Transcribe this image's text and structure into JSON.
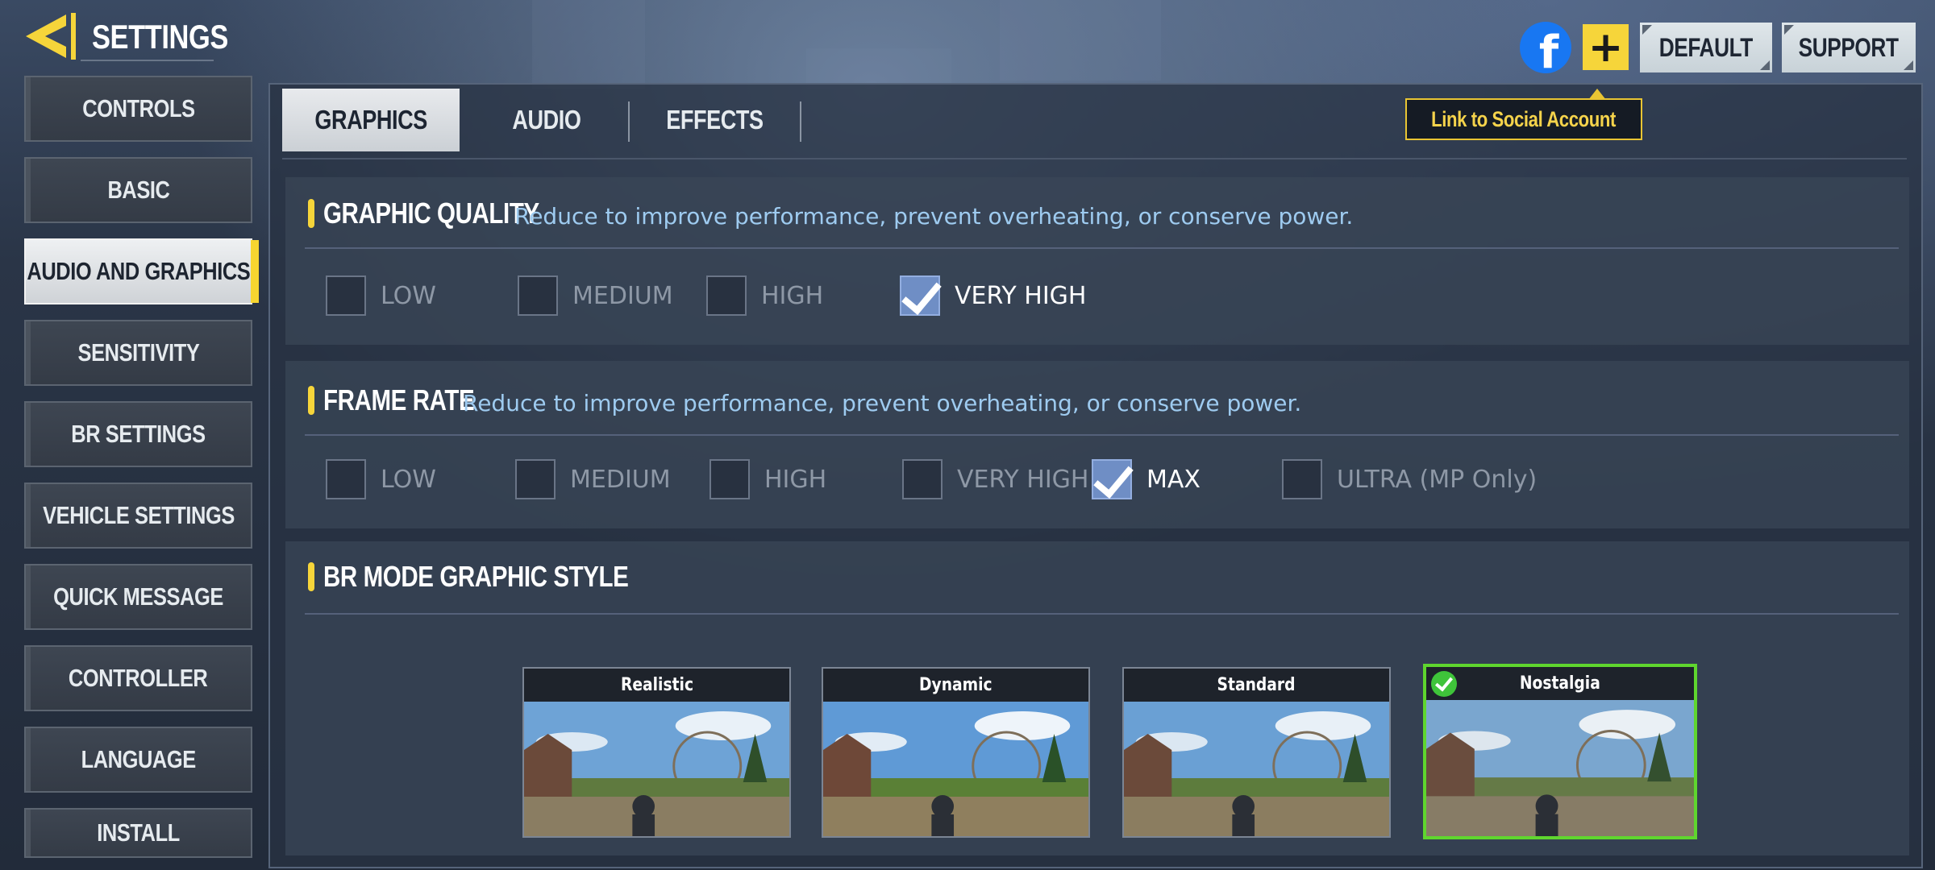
{
  "header": {
    "title": "SETTINGS",
    "back_icon": "back-arrow-icon"
  },
  "sidebar": {
    "items": [
      {
        "label": "CONTROLS",
        "active": false
      },
      {
        "label": "BASIC",
        "active": false
      },
      {
        "label": "AUDIO AND GRAPHICS",
        "active": true
      },
      {
        "label": "SENSITIVITY",
        "active": false
      },
      {
        "label": "BR SETTINGS",
        "active": false
      },
      {
        "label": "VEHICLE SETTINGS",
        "active": false
      },
      {
        "label": "QUICK MESSAGE",
        "active": false
      },
      {
        "label": "CONTROLLER",
        "active": false
      },
      {
        "label": "LANGUAGE",
        "active": false
      },
      {
        "label": "INSTALL",
        "active": false
      }
    ],
    "accent": "#f7d530"
  },
  "tabs": [
    {
      "label": "GRAPHICS",
      "active": true
    },
    {
      "label": "AUDIO",
      "active": false
    },
    {
      "label": "EFFECTS",
      "active": false
    }
  ],
  "top_actions": {
    "facebook_glyph": "f",
    "add_glyph": "+",
    "default_label": "DEFAULT",
    "support_label": "SUPPORT",
    "tooltip": "Link to Social Account"
  },
  "graphic_quality": {
    "title": "GRAPHIC QUALITY",
    "description": "Reduce to improve performance, prevent overheating, or conserve power.",
    "options": [
      {
        "label": "LOW",
        "checked": false
      },
      {
        "label": "MEDIUM",
        "checked": false
      },
      {
        "label": "HIGH",
        "checked": false
      },
      {
        "label": "VERY HIGH",
        "checked": true
      }
    ]
  },
  "frame_rate": {
    "title": "FRAME RATE",
    "description": "Reduce to improve performance, prevent overheating, or conserve power.",
    "options": [
      {
        "label": "LOW",
        "checked": false
      },
      {
        "label": "MEDIUM",
        "checked": false
      },
      {
        "label": "HIGH",
        "checked": false
      },
      {
        "label": "VERY HIGH",
        "checked": false
      },
      {
        "label": "MAX",
        "checked": true
      },
      {
        "label": "ULTRA (MP Only)",
        "checked": false
      }
    ]
  },
  "br_style": {
    "title": "BR MODE GRAPHIC STYLE",
    "styles": [
      {
        "label": "Realistic",
        "selected": false
      },
      {
        "label": "Dynamic",
        "selected": false
      },
      {
        "label": "Standard",
        "selected": false
      },
      {
        "label": "Nostalgia",
        "selected": true
      }
    ],
    "selected_color": "#5fd62e"
  }
}
